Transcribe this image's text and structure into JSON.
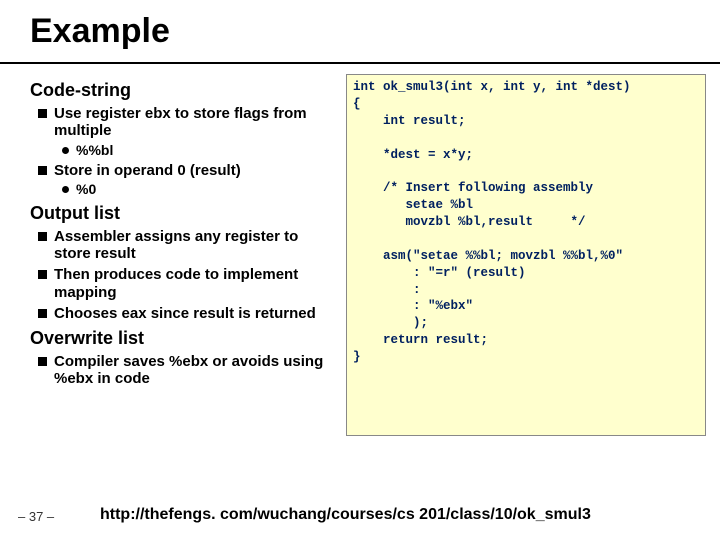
{
  "title": "Example",
  "left": {
    "h2_a": "Code-string",
    "a_items": [
      {
        "text": "Use register ebx to store flags from multiple",
        "sub": [
          "%%bl"
        ]
      },
      {
        "text": "Store in operand 0 (result)",
        "sub": [
          "%0"
        ]
      }
    ],
    "h2_b": "Output list",
    "b_items": [
      {
        "text": "Assembler assigns any register to store result"
      },
      {
        "text": "Then produces code to implement mapping"
      },
      {
        "text": "Chooses eax since result is returned"
      }
    ],
    "h2_c": "Overwrite list",
    "c_items": [
      {
        "text": "Compiler saves %ebx or avoids using %ebx in code"
      }
    ]
  },
  "code": "int ok_smul3(int x, int y, int *dest)\n{\n    int result;\n\n    *dest = x*y;\n\n    /* Insert following assembly\n       setae %bl\n       movzbl %bl,result     */\n\n    asm(\"setae %%bl; movzbl %%bl,%0\"\n        : \"=r\" (result)\n        :\n        : \"%ebx\"\n        );\n    return result;\n}",
  "page": "– 37 –",
  "url": "http://thefengs. com/wuchang/courses/cs 201/class/10/ok_smul3"
}
